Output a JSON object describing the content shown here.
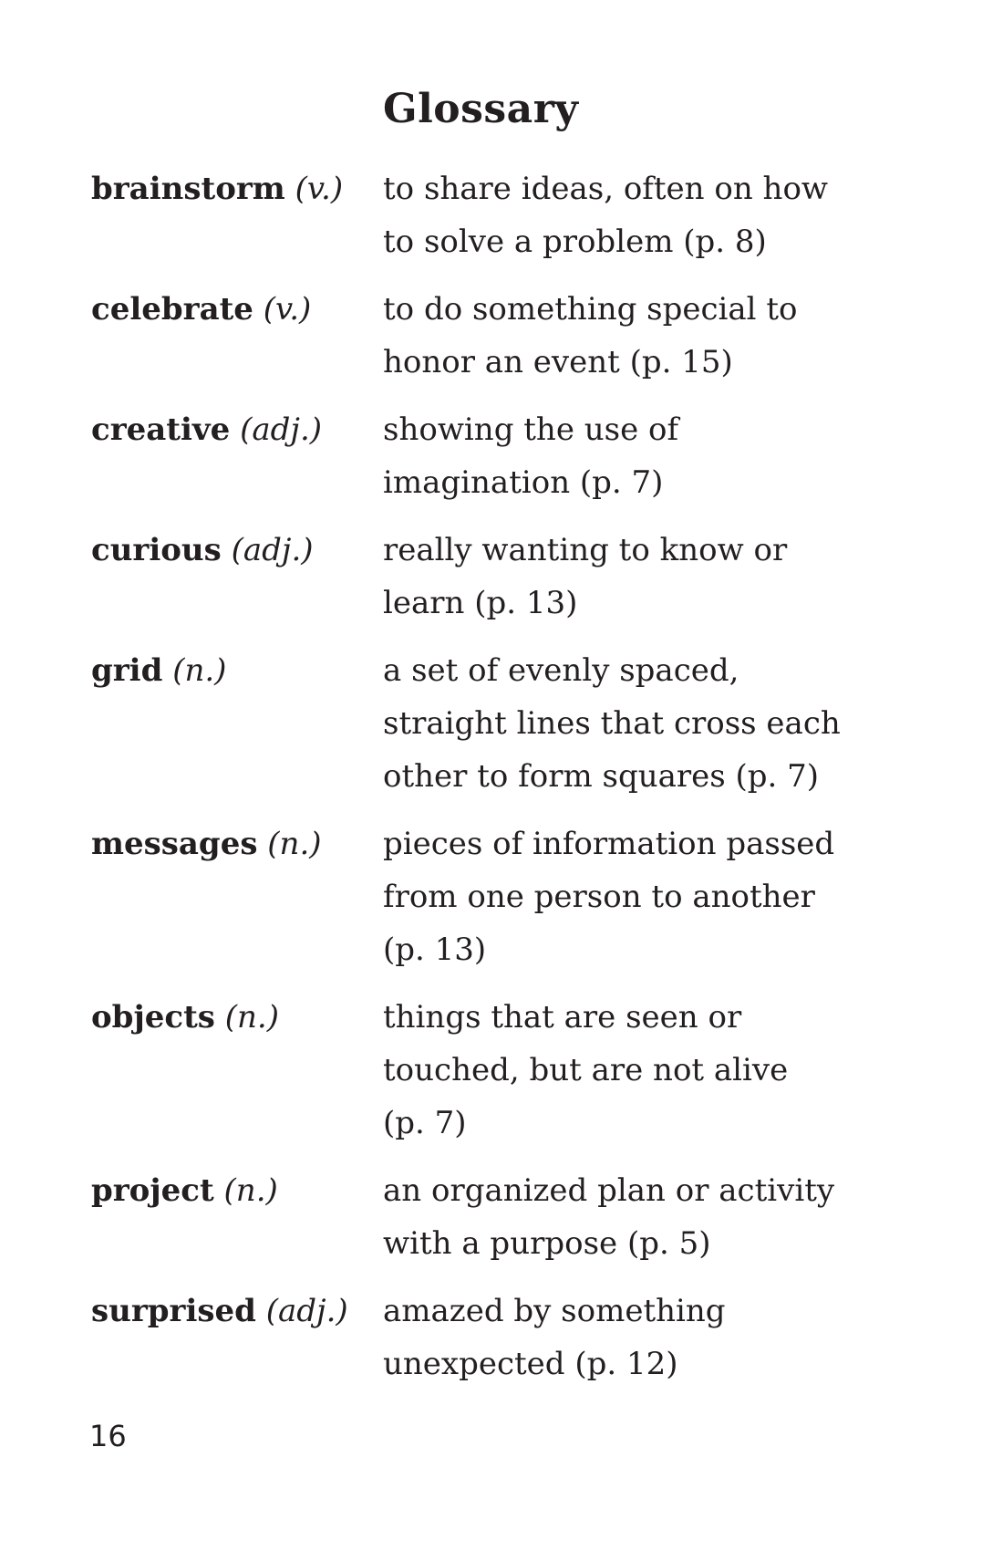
{
  "title": "Glossary",
  "entries": [
    {
      "term": "brainstorm",
      "pos": "(v.)",
      "lines": [
        "to share ideas, often on how",
        "to solve a problem (p. 8)"
      ]
    },
    {
      "term": "celebrate",
      "pos": "(v.)",
      "lines": [
        "to do something special to",
        "honor an event (p. 15)"
      ]
    },
    {
      "term": "creative",
      "pos": "(adj.)",
      "lines": [
        "showing the use of",
        "imagination (p. 7)"
      ]
    },
    {
      "term": "curious",
      "pos": "(adj.)",
      "lines": [
        "really wanting to know or",
        "learn (p. 13)"
      ]
    },
    {
      "term": "grid",
      "pos": "(n.)",
      "lines": [
        "a set of evenly spaced,",
        "straight lines that cross each",
        "other to form squares (p. 7)"
      ]
    },
    {
      "term": "messages",
      "pos": "(n.)",
      "lines": [
        "pieces of information passed",
        "from one person to another",
        "(p. 13)"
      ]
    },
    {
      "term": "objects",
      "pos": "(n.)",
      "lines": [
        "things that are seen or",
        "touched, but are not alive",
        "(p. 7)"
      ]
    },
    {
      "term": "project",
      "pos": "(n.)",
      "lines": [
        "an organized plan or activity",
        "with a purpose (p. 5)"
      ]
    },
    {
      "term": "surprised",
      "pos": "(adj.)",
      "lines": [
        "amazed by something",
        "unexpected (p. 12)"
      ]
    }
  ],
  "page_number": "16"
}
